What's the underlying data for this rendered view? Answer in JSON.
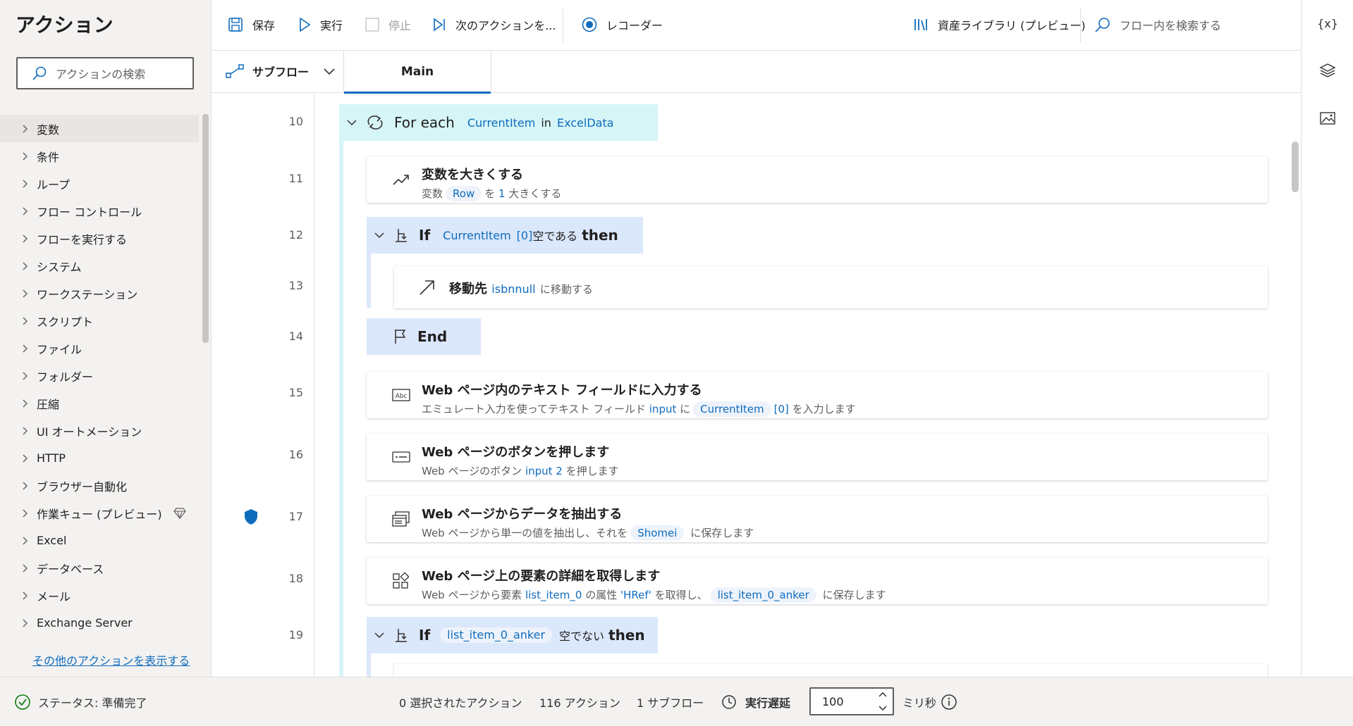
{
  "left": {
    "title": "アクション",
    "search_placeholder": "アクションの検索",
    "categories": [
      {
        "label": "変数"
      },
      {
        "label": "条件"
      },
      {
        "label": "ループ"
      },
      {
        "label": "フロー コントロール"
      },
      {
        "label": "フローを実行する"
      },
      {
        "label": "システム"
      },
      {
        "label": "ワークステーション"
      },
      {
        "label": "スクリプト"
      },
      {
        "label": "ファイル"
      },
      {
        "label": "フォルダー"
      },
      {
        "label": "圧縮"
      },
      {
        "label": "UI オートメーション"
      },
      {
        "label": "HTTP"
      },
      {
        "label": "ブラウザー自動化"
      },
      {
        "label": "作業キュー (プレビュー)"
      },
      {
        "label": "Excel"
      },
      {
        "label": "データベース"
      },
      {
        "label": "メール"
      },
      {
        "label": "Exchange Server"
      }
    ],
    "more_link": "その他のアクションを表示する"
  },
  "toolbar": {
    "save": "保存",
    "run": "実行",
    "stop": "停止",
    "next": "次のアクションを...",
    "recorder": "レコーダー",
    "library": "資産ライブラリ (プレビュー)",
    "search_placeholder": "フロー内を検索する"
  },
  "rightbar": {
    "variables_label": "{x}"
  },
  "tabs": {
    "subflow": "サブフロー",
    "main": "Main"
  },
  "lines": [
    "10",
    "11",
    "12",
    "13",
    "14",
    "15",
    "16",
    "17",
    "18",
    "19"
  ],
  "flow": {
    "foreach": {
      "keyword": "For each",
      "var": "CurrentItem",
      "in": "in",
      "collection": "ExcelData"
    },
    "increase": {
      "title": "変数を大きくする",
      "d1": "変数",
      "var": "Row",
      "d2": "を",
      "num": "1",
      "d3": "大きくする"
    },
    "if1": {
      "keyword": "If",
      "var": "CurrentItem",
      "index": "[0]",
      "cond": "空である",
      "then": "then"
    },
    "goto": {
      "title": "移動先",
      "label": "isbnnull",
      "suffix": "に移動する"
    },
    "end": {
      "keyword": "End"
    },
    "web_input": {
      "title": "Web ページ内のテキスト フィールドに入力する",
      "d1": "エミュレート入力を使ってテキスト フィールド",
      "field": "input",
      "d2": "に",
      "var": "CurrentItem",
      "index": "[0]",
      "d3": "を入力します"
    },
    "web_button": {
      "title": "Web ページのボタンを押します",
      "d1": "Web ページのボタン",
      "button": "input 2",
      "d2": "を押します"
    },
    "web_extract": {
      "title": "Web ページからデータを抽出する",
      "d1": "Web ページから単一の値を抽出し、それを",
      "var": "Shomei",
      "d2": "に保存します"
    },
    "web_details": {
      "title": "Web ページ上の要素の詳細を取得します",
      "d1": "Web ページから要素",
      "element": "list_item_0",
      "d2": "の属性",
      "attr": "'HRef'",
      "d3": "を取得し、",
      "var": "list_item_0_anker",
      "d4": "に保存します"
    },
    "if2": {
      "keyword": "If",
      "var": "list_item_0_anker",
      "cond": "空でない",
      "then": "then"
    }
  },
  "status": {
    "state": "ステータス: 準備完了",
    "selected": "0 選択されたアクション",
    "actions": "116 アクション",
    "subflows": "1 サブフロー",
    "delay_label": "実行遅延",
    "delay_value": "100",
    "unit": "ミリ秒"
  },
  "colors": {
    "accent": "#0f6cbd",
    "loop_bg": "#d6f5f7",
    "if_bg": "#dbe7fb",
    "status_ok": "#107c10"
  }
}
